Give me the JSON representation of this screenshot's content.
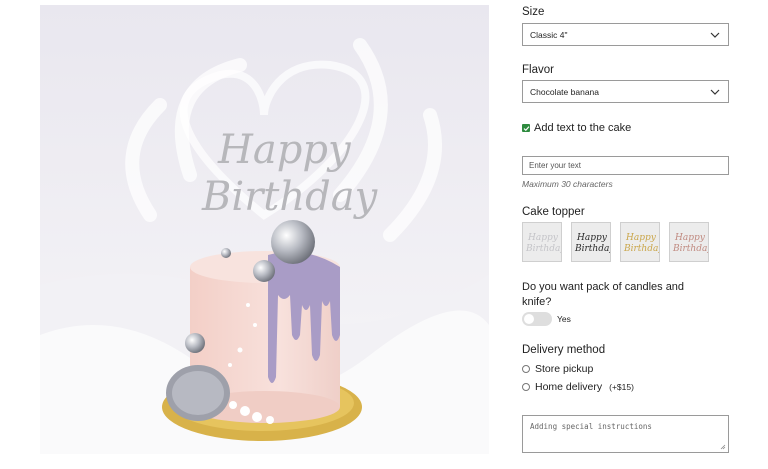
{
  "size": {
    "label": "Size",
    "selected": "Classic 4\""
  },
  "flavor": {
    "label": "Flavor",
    "selected": "Chocolate banana"
  },
  "add_text": {
    "label": "Add text to the cake",
    "checked": true,
    "placeholder": "Enter your text",
    "hint": "Maximum 30 characters"
  },
  "topper": {
    "label": "Cake topper",
    "options": [
      {
        "name": "silver",
        "text": "Happy Birthday",
        "color": "#c4c4c8"
      },
      {
        "name": "black",
        "text": "Happy Birthday",
        "color": "#2a2a2a"
      },
      {
        "name": "gold",
        "text": "Happy Birthday",
        "color": "#caa64a"
      },
      {
        "name": "rose-gold",
        "text": "Happy Birthday",
        "color": "#c08a80"
      }
    ]
  },
  "candles": {
    "question": "Do you want pack of candles and knife?",
    "toggle_label": "Yes",
    "on": false
  },
  "delivery": {
    "label": "Delivery method",
    "options": [
      {
        "label": "Store pickup",
        "price": ""
      },
      {
        "label": "Home delivery",
        "price": "(+$15)"
      }
    ]
  },
  "instructions": {
    "placeholder": "Adding special instructions"
  },
  "photo": {
    "topper_text_1": "Happy",
    "topper_text_2": "Birthday"
  },
  "colors": {
    "checkbox": "#2e8b3f",
    "drip": "#a99cc6",
    "cake": "#f5d8d2",
    "board": "#d8b24a"
  }
}
